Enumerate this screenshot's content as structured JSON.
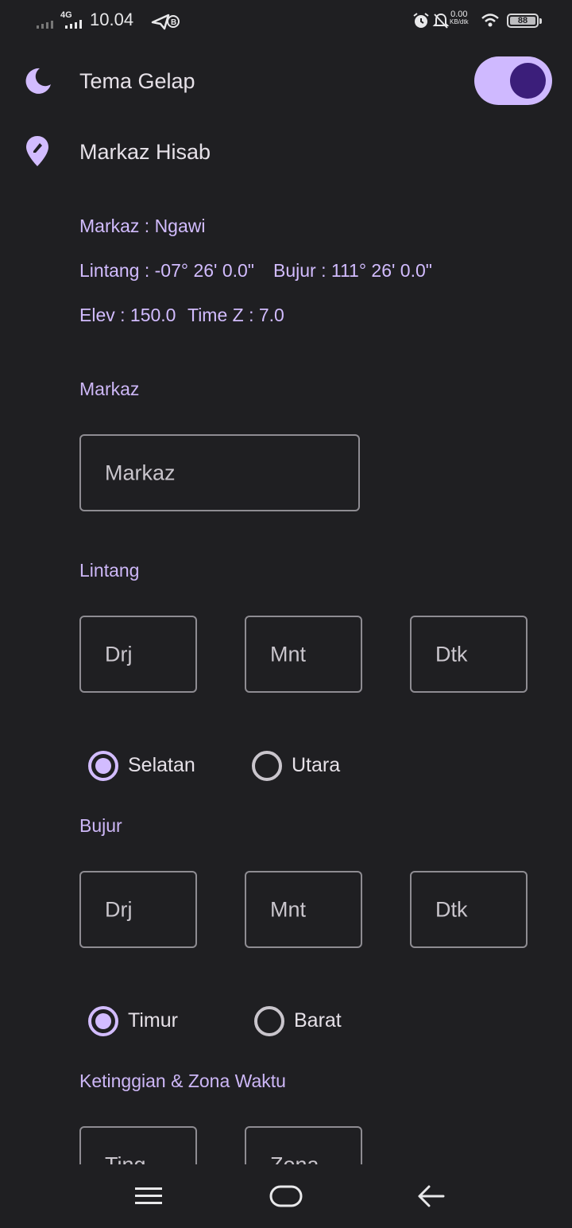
{
  "status_bar": {
    "network": "4G",
    "time": "10.04",
    "speed_value": "0.00",
    "speed_unit": "KB/dtk",
    "battery": "88"
  },
  "theme_row": {
    "label": "Tema Gelap",
    "toggle_on": true
  },
  "markaz_row": {
    "label": "Markaz Hisab"
  },
  "info": {
    "markaz": "Markaz : Ngawi",
    "lintang": "Lintang : -07° 26' 0.0\"",
    "bujur": "Bujur : 111° 26' 0.0\"",
    "elev": "Elev : 150.0",
    "timez": "Time Z : 7.0"
  },
  "form": {
    "markaz_section": "Markaz",
    "markaz_placeholder": "Markaz",
    "lintang_section": "Lintang",
    "lintang_fields": [
      "Drj",
      "Mnt",
      "Dtk"
    ],
    "lintang_options": [
      {
        "label": "Selatan",
        "selected": true
      },
      {
        "label": "Utara",
        "selected": false
      }
    ],
    "bujur_section": "Bujur",
    "bujur_fields": [
      "Drj",
      "Mnt",
      "Dtk"
    ],
    "bujur_options": [
      {
        "label": "Timur",
        "selected": true
      },
      {
        "label": "Barat",
        "selected": false
      }
    ],
    "elev_section": "Ketinggian & Zona Waktu",
    "elev_fields": [
      "Ting",
      "Zona"
    ]
  },
  "colors": {
    "background": "#1f1f22",
    "accent": "#d2bcff",
    "toggle_knob": "#3b1e7a"
  }
}
